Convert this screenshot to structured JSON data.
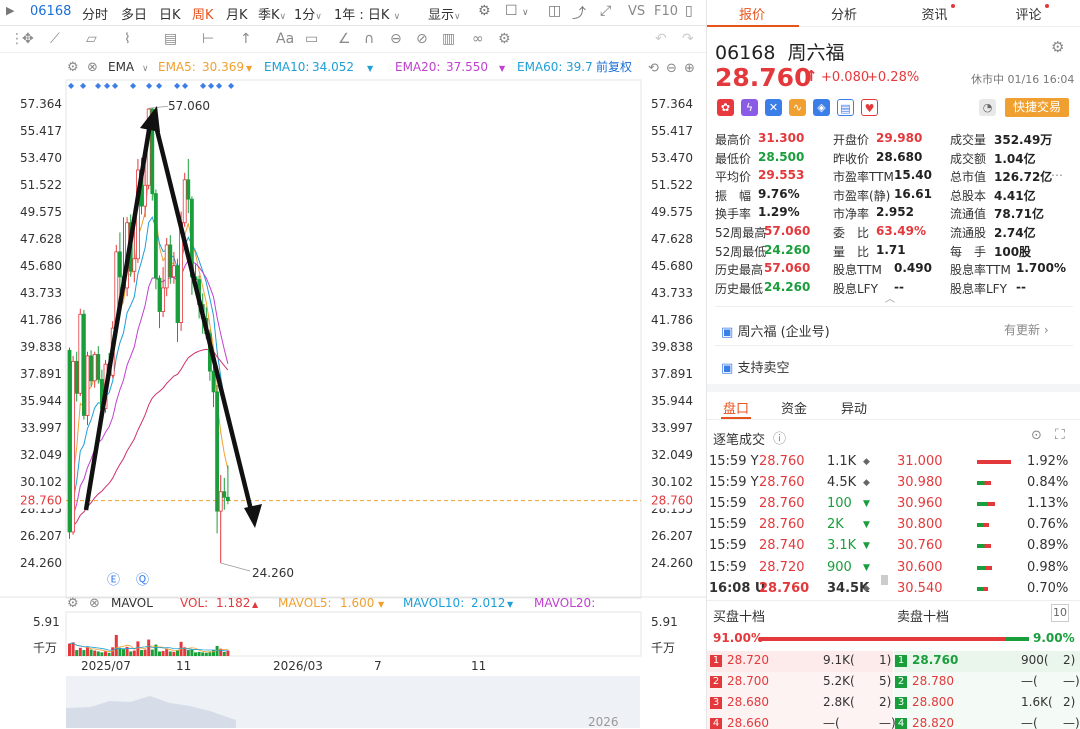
{
  "toolbar": {
    "code": "06168",
    "items": [
      {
        "label": "分时",
        "active": false
      },
      {
        "label": "多日",
        "active": false
      },
      {
        "label": "日K",
        "active": false
      },
      {
        "label": "周K",
        "active": true
      },
      {
        "label": "月K",
        "active": false
      },
      {
        "label": "季K",
        "active": false
      },
      {
        "label": "1分",
        "active": false
      },
      {
        "label": "1年 : 日K",
        "active": false
      },
      {
        "label": "显示",
        "active": false
      }
    ],
    "vs": "VS",
    "f10": "F10"
  },
  "chart": {
    "indicator": "EMA",
    "ema5_label": "EMA5:",
    "ema5": "30.369",
    "ema10_label": "EMA10:",
    "ema10": "34.052",
    "ema20_label": "EMA20:",
    "ema20": "37.550",
    "ema60_label": "EMA60:",
    "ema60": "39.7",
    "adj": "前复权",
    "y_ticks": [
      "57.364",
      "55.417",
      "53.470",
      "51.522",
      "49.575",
      "47.628",
      "45.680",
      "43.733",
      "41.786",
      "39.838",
      "37.891",
      "35.944",
      "33.997",
      "32.049",
      "30.102",
      "28.155",
      "26.207",
      "24.260"
    ],
    "last_price": "28.760",
    "high_label": "57.060",
    "low_label": "24.260",
    "vol_indicator": "MAVOL",
    "vol_label": "VOL:",
    "vol": "1.182",
    "mavol5_label": "MAVOL5:",
    "mavol5": "1.600",
    "mavol10_label": "MAVOL10:",
    "mavol10": "2.012",
    "mavol20_label": "MAVOL20:",
    "vol_max": "5.91",
    "vol_unit": "千万",
    "x_labels": [
      "2025/07",
      "11",
      "2026/03",
      "7",
      "11"
    ],
    "nav_year": "2026",
    "colors": {
      "up": "#e4393c",
      "down": "#1a9e3c",
      "ema5": "#f0a030",
      "ema10": "#1e9fd6",
      "ema20": "#c040d0",
      "ema60": "#d03070"
    },
    "candles": [
      [
        39.6,
        26.5,
        39.8,
        26.0
      ],
      [
        26.5,
        38.8,
        39.2,
        26.3
      ],
      [
        38.8,
        36.5,
        39.5,
        35.9
      ],
      [
        36.5,
        42.2,
        42.6,
        36.3
      ],
      [
        42.2,
        34.9,
        42.5,
        34.6
      ],
      [
        34.9,
        39.2,
        39.5,
        34.2
      ],
      [
        39.2,
        37.4,
        39.6,
        37.0
      ],
      [
        37.4,
        39.3,
        39.5,
        36.9
      ],
      [
        39.3,
        37.5,
        39.9,
        37.2
      ],
      [
        37.5,
        35.4,
        38.2,
        35.2
      ],
      [
        35.4,
        38.6,
        38.9,
        35.1
      ],
      [
        38.6,
        37.8,
        39.4,
        37.5
      ],
      [
        37.8,
        41.2,
        41.7,
        37.6
      ],
      [
        41.2,
        46.7,
        47.2,
        40.8
      ],
      [
        46.7,
        44.9,
        48.1,
        43.6
      ],
      [
        44.9,
        44.1,
        49.2,
        43.8
      ],
      [
        44.1,
        48.8,
        49.2,
        43.5
      ],
      [
        48.8,
        45.3,
        49.4,
        44.9
      ],
      [
        45.3,
        46.2,
        48.6,
        44.5
      ],
      [
        46.2,
        52.6,
        53.4,
        45.9
      ],
      [
        52.6,
        50.0,
        53.5,
        49.4
      ],
      [
        50.0,
        51.5,
        53.8,
        49.2
      ],
      [
        51.5,
        57.0,
        57.06,
        51.2
      ],
      [
        57.0,
        50.9,
        57.06,
        50.4
      ],
      [
        50.9,
        44.8,
        51.2,
        44.0
      ],
      [
        44.8,
        42.4,
        45.0,
        41.2
      ],
      [
        42.4,
        44.1,
        45.6,
        42.0
      ],
      [
        44.1,
        47.2,
        47.7,
        43.5
      ],
      [
        47.2,
        44.9,
        47.9,
        44.4
      ],
      [
        44.9,
        45.7,
        46.7,
        44.4
      ],
      [
        45.7,
        41.6,
        46.2,
        40.2
      ],
      [
        41.6,
        48.8,
        49.6,
        41.0
      ],
      [
        48.8,
        51.9,
        52.4,
        48.5
      ],
      [
        51.9,
        50.5,
        53.4,
        49.5
      ],
      [
        50.5,
        44.9,
        50.7,
        43.6
      ],
      [
        44.9,
        44.7,
        45.8,
        43.7
      ],
      [
        44.7,
        42.9,
        45.0,
        41.9
      ],
      [
        42.9,
        41.9,
        43.7,
        40.8
      ],
      [
        41.9,
        40.8,
        42.7,
        40.4
      ],
      [
        40.8,
        38.1,
        41.1,
        37.4
      ],
      [
        38.1,
        36.6,
        38.8,
        35.5
      ],
      [
        36.6,
        28.0,
        37.1,
        26.4
      ],
      [
        28.0,
        29.4,
        30.6,
        24.26
      ],
      [
        29.4,
        29.0,
        30.4,
        28.1
      ],
      [
        29.0,
        28.76,
        31.3,
        28.5
      ]
    ],
    "vol_bars": [
      [
        2.7,
        1
      ],
      [
        3.0,
        1
      ],
      [
        1.3,
        0
      ],
      [
        1.8,
        1
      ],
      [
        1.3,
        0
      ],
      [
        2.1,
        1
      ],
      [
        1.4,
        0
      ],
      [
        1.2,
        1
      ],
      [
        1.0,
        0
      ],
      [
        0.8,
        0
      ],
      [
        1.0,
        1
      ],
      [
        0.7,
        0
      ],
      [
        1.9,
        1
      ],
      [
        4.6,
        1
      ],
      [
        1.8,
        0
      ],
      [
        1.5,
        0
      ],
      [
        2.0,
        1
      ],
      [
        1.0,
        0
      ],
      [
        1.2,
        1
      ],
      [
        3.2,
        1
      ],
      [
        1.3,
        0
      ],
      [
        1.4,
        1
      ],
      [
        3.6,
        1
      ],
      [
        1.4,
        0
      ],
      [
        2.5,
        0
      ],
      [
        1.0,
        0
      ],
      [
        1.1,
        1
      ],
      [
        1.6,
        1
      ],
      [
        1.0,
        0
      ],
      [
        0.9,
        1
      ],
      [
        1.3,
        0
      ],
      [
        3.1,
        1
      ],
      [
        1.9,
        1
      ],
      [
        1.3,
        0
      ],
      [
        1.4,
        0
      ],
      [
        0.8,
        0
      ],
      [
        0.9,
        0
      ],
      [
        0.8,
        0
      ],
      [
        0.7,
        0
      ],
      [
        1.0,
        0
      ],
      [
        1.3,
        0
      ],
      [
        2.2,
        0
      ],
      [
        1.6,
        1
      ],
      [
        0.9,
        0
      ],
      [
        1.2,
        1
      ]
    ]
  },
  "quote": {
    "code": "06168",
    "name": "周六福",
    "price": "28.760",
    "arrow": "↑",
    "change": "+0.080",
    "pct": "+0.28%",
    "status": "休市中 01/16 16:04",
    "fast_trade": "快捷交易",
    "stats": [
      [
        {
          "k": "最高价",
          "v": "31.300",
          "c": "red"
        },
        {
          "k": "开盘价",
          "v": "29.980",
          "c": "red"
        },
        {
          "k": "成交量",
          "v": "352.49万",
          "c": ""
        }
      ],
      [
        {
          "k": "最低价",
          "v": "28.500",
          "c": "green"
        },
        {
          "k": "昨收价",
          "v": "28.680",
          "c": "g"
        },
        {
          "k": "成交额",
          "v": "1.04亿",
          "c": ""
        }
      ],
      [
        {
          "k": "平均价",
          "v": "29.553",
          "c": "red"
        },
        {
          "k": "市盈率TTM",
          "v": "15.40",
          "c": ""
        },
        {
          "k": "总市值",
          "v": "126.72亿",
          "c": ""
        }
      ],
      [
        {
          "k": "振　幅",
          "v": "9.76%",
          "c": ""
        },
        {
          "k": "市盈率(静)",
          "v": "16.61",
          "c": ""
        },
        {
          "k": "总股本",
          "v": "4.41亿",
          "c": ""
        }
      ],
      [
        {
          "k": "换手率",
          "v": "1.29%",
          "c": ""
        },
        {
          "k": "市净率",
          "v": "2.952",
          "c": ""
        },
        {
          "k": "流通值",
          "v": "78.71亿",
          "c": ""
        }
      ],
      [
        {
          "k": "52周最高",
          "v": "57.060",
          "c": "red"
        },
        {
          "k": "委　比",
          "v": "63.49%",
          "c": "red"
        },
        {
          "k": "流通股",
          "v": "2.74亿",
          "c": ""
        }
      ],
      [
        {
          "k": "52周最低",
          "v": "24.260",
          "c": "green"
        },
        {
          "k": "量　比",
          "v": "1.71",
          "c": ""
        },
        {
          "k": "每　手",
          "v": "100股",
          "c": ""
        }
      ],
      [
        {
          "k": "历史最高",
          "v": "57.060",
          "c": "red"
        },
        {
          "k": "股息TTM",
          "v": "0.490",
          "c": ""
        },
        {
          "k": "股息率TTM",
          "v": "1.700%",
          "c": ""
        }
      ],
      [
        {
          "k": "历史最低",
          "v": "24.260",
          "c": "green"
        },
        {
          "k": "股息LFY",
          "v": "--",
          "c": ""
        },
        {
          "k": "股息率LFY",
          "v": "--",
          "c": ""
        }
      ]
    ],
    "company_label": "周六福 (企业号)",
    "company_update": "有更新",
    "short_sell": "支持卖空"
  },
  "rtabs": [
    "报价",
    "分析",
    "资讯",
    "评论"
  ],
  "subtabs": [
    "盘口",
    "资金",
    "异动"
  ],
  "ticks_title": "逐笔成交",
  "ticks": [
    {
      "t": "15:59 Y",
      "p": "28.760",
      "v": "1.1K",
      "dir": "n",
      "bp": "31.000",
      "pct": "1.92%",
      "w": 34
    },
    {
      "t": "15:59 Y",
      "p": "28.760",
      "v": "4.5K",
      "dir": "n",
      "bp": "30.980",
      "pct": "0.84%",
      "w": 14
    },
    {
      "t": "15:59",
      "p": "28.760",
      "v": "100",
      "dir": "d",
      "bp": "30.960",
      "pct": "1.13%",
      "w": 18
    },
    {
      "t": "15:59",
      "p": "28.760",
      "v": "2K",
      "dir": "d",
      "bp": "30.800",
      "pct": "0.76%",
      "w": 12
    },
    {
      "t": "15:59",
      "p": "28.740",
      "v": "3.1K",
      "dir": "d",
      "bp": "30.760",
      "pct": "0.89%",
      "w": 14
    },
    {
      "t": "15:59",
      "p": "28.720",
      "v": "900",
      "dir": "d",
      "bp": "30.600",
      "pct": "0.98%",
      "w": 15
    },
    {
      "t": "16:08 U",
      "p": "28.760",
      "v": "34.5K",
      "dir": "n",
      "bp": "30.540",
      "pct": "0.70%",
      "w": 11
    }
  ],
  "book": {
    "buy_title": "买盘十档",
    "sell_title": "卖盘十档",
    "ten": "10",
    "buy_pct": "91.00%",
    "sell_pct": "9.00%",
    "buy_ratio": 0.91,
    "rows": [
      {
        "n": "1",
        "bp": "28.720",
        "bv": "9.1K(",
        "bc": "1)",
        "sn": "1",
        "sp": "28.760",
        "sv": "900(",
        "sc": "2)"
      },
      {
        "n": "2",
        "bp": "28.700",
        "bv": "5.2K(",
        "bc": "5)",
        "sn": "2",
        "sp": "28.780",
        "sv": "—(",
        "sc": "—)"
      },
      {
        "n": "3",
        "bp": "28.680",
        "bv": "2.8K(",
        "bc": "2)",
        "sn": "3",
        "sp": "28.800",
        "sv": "1.6K(",
        "sc": "2)"
      },
      {
        "n": "4",
        "bp": "28.660",
        "bv": "—(",
        "bc": "—)",
        "sn": "4",
        "sp": "28.820",
        "sv": "—(",
        "sc": "—)"
      }
    ]
  }
}
